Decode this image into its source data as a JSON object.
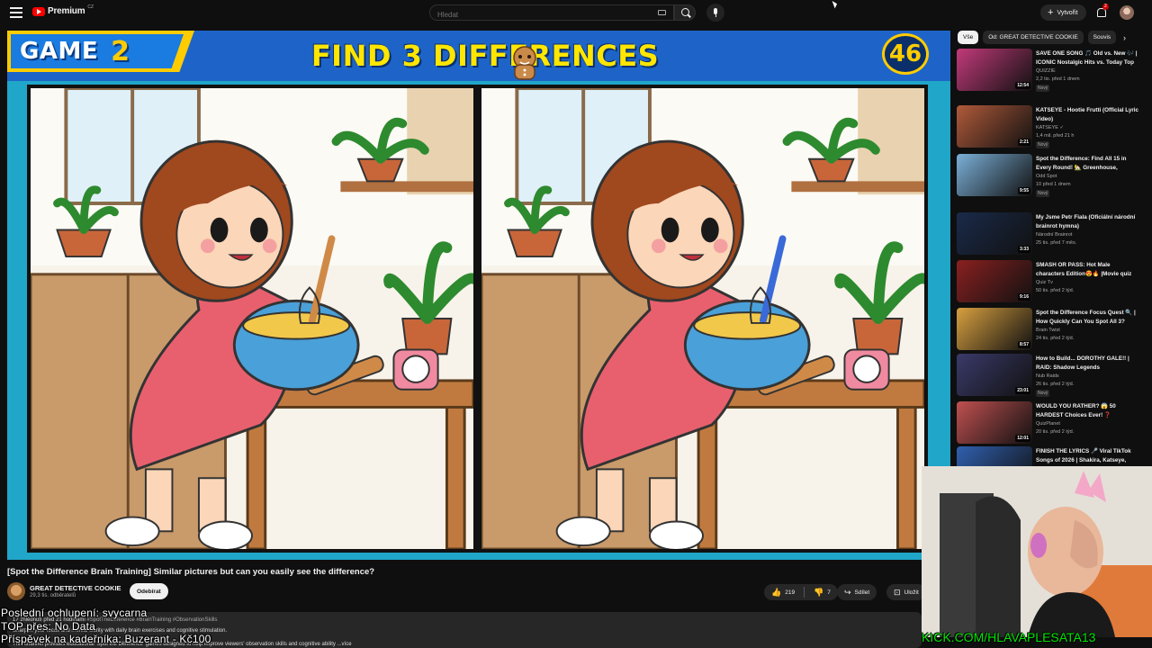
{
  "header": {
    "logo_text": "Premium",
    "logo_country": "CZ",
    "search_placeholder": "Hledat",
    "create_label": "Vytvořit",
    "notification_count": "2"
  },
  "video": {
    "game_label": "GAME",
    "game_number": "2",
    "banner_title": "FIND 3 DIFFERENCES",
    "timer": "46"
  },
  "details": {
    "title": "[Spot the Difference Brain Training] Similar pictures but can you easily see the difference?",
    "channel_name": "GREAT DETECTIVE COOKIE",
    "subscribers": "29,3 tis. odběratelů",
    "subscribe_label": "Odebírat",
    "likes": "219",
    "dislikes": "7",
    "share_label": "Sdílet",
    "save_label": "Uložit",
    "description_meta": "17 zhlédnutí  před 21 hodinami",
    "description_tags": "#SpotTheDifference #BrainTraining #ObservationSkills",
    "description_line2": "Sharpen your focus and mental clarity with daily brain exercises and cognitive stimulation.",
    "description_line3": "This channel provides educational 'Spot the Difference' games designed to help improve viewers' observation skills and cognitive ability ...více"
  },
  "overlay": {
    "line1": "Poslední ochlupení: svycarna",
    "line2": "TOP přes: No Data",
    "line3": "Příspěvek na kadeřníka: Buzerant - Kč100",
    "kick_url": "KICK.COM/HLAVAPLESATA13"
  },
  "sidebar": {
    "chips": [
      "Vše",
      "Od: GREAT DETECTIVE COOKIE",
      "Souvis"
    ],
    "recommendations": [
      {
        "title": "SAVE ONE SONG 🎵 Old vs. New 🎶 | ICONIC Nostalgic Hits vs. Today Top Trending Hits | Music Quiz",
        "channel": "QUIZZIE",
        "meta": "2,2 tis.  před 1 dnem",
        "badge": "Nový",
        "duration": "12:54",
        "color": "#c23a7a"
      },
      {
        "title": "KATSEYE - Hootie Frutti (Official Lyric Video)",
        "channel": "KATSEYE ✓",
        "meta": "1,4 mil.  před 21 h",
        "badge": "Nový",
        "duration": "2:21",
        "color": "#b05a3a"
      },
      {
        "title": "Spot the Difference: Find All 15 in Every Round! 🏡 Greenhouse, Workshop & Treehouse Brain Game",
        "channel": "Odd Spot",
        "meta": "10  před 1 dnem",
        "badge": "Nový",
        "duration": "9:55",
        "color": "#7bb0d8"
      },
      {
        "title": "My Jsme Petr Fiala (Oficiální národní brainrot hymna)",
        "channel": "Národní Brainrot",
        "meta": "25 tis.  před 7 měs.",
        "badge": "",
        "duration": "3:33",
        "color": "#1a2a4a"
      },
      {
        "title": "SMASH OR PASS: Hot Male characters Edition😍🔥 |Movie quiz",
        "channel": "Quiz Tv",
        "meta": "50 tis.  před 2 týd.",
        "badge": "",
        "duration": "9:16",
        "color": "#8a2020"
      },
      {
        "title": "Spot the Difference Focus Quest 🔍 | How Quickly Can You Spot All 3?",
        "channel": "Brain Twist",
        "meta": "24 tis.  před 2 týd.",
        "badge": "",
        "duration": "8:57",
        "color": "#d8a040"
      },
      {
        "title": "How to Build... DOROTHY GALE!! | RAID: Shadow Legends",
        "channel": "Nub Raids",
        "meta": "26 tis.  před 2 týd.",
        "badge": "Nový",
        "duration": "23:01",
        "color": "#3a3a6a"
      },
      {
        "title": "WOULD YOU RATHER? 😱 50 HARDEST Choices Ever! ❓",
        "channel": "QuizPlanet",
        "meta": "20 tis.  před 2 týd.",
        "badge": "",
        "duration": "12:01",
        "color": "#c05050"
      },
      {
        "title": "FINISH THE LYRICS 🎤 Viral TikTok Songs of 2026 | Shakira, Katseye, Olivia Rodrigo",
        "channel": "",
        "meta": "",
        "badge": "",
        "duration": "",
        "color": "#3060b0"
      }
    ]
  }
}
